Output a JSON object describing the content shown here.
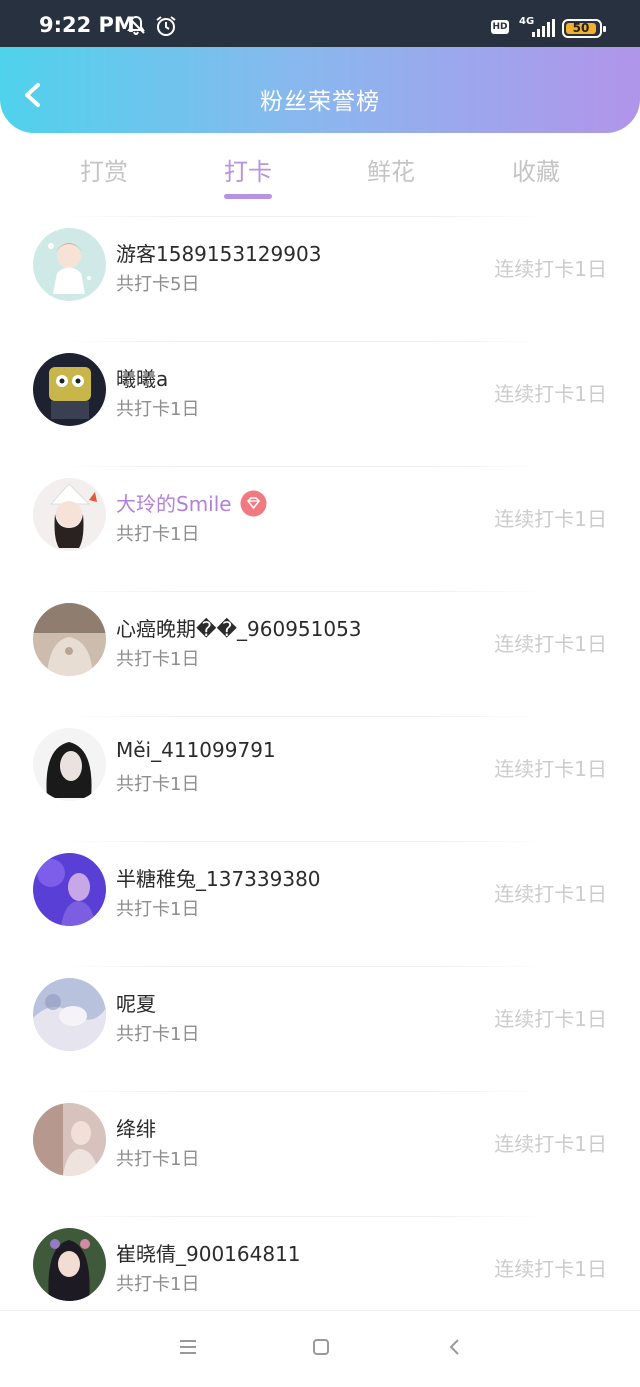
{
  "status_bar": {
    "time": "9:22 PM",
    "hd": "HD",
    "network": "4G",
    "battery": "50",
    "icons": [
      "bell-off-icon",
      "alarm-icon",
      "signal-icon",
      "battery-icon"
    ]
  },
  "header": {
    "title": "粉丝荣誉榜",
    "back_icon": "chevron-left-icon",
    "gradient": [
      "#4fd2ec",
      "#87b9ef",
      "#b195ea"
    ]
  },
  "tabs": [
    {
      "label": "打赏",
      "active": false
    },
    {
      "label": "打卡",
      "active": true
    },
    {
      "label": "鲜花",
      "active": false
    },
    {
      "label": "收藏",
      "active": false
    }
  ],
  "accent_color": "#b893e3",
  "fans": [
    {
      "name": "游客1589153129903",
      "total": "共打卡5日",
      "streak": "连续打卡1日",
      "vip": false
    },
    {
      "name": "曦曦a",
      "total": "共打卡1日",
      "streak": "连续打卡1日",
      "vip": false
    },
    {
      "name": "大玲的Smile",
      "total": "共打卡1日",
      "streak": "连续打卡1日",
      "vip": true
    },
    {
      "name": "心癌晚期��_960951053",
      "total": "共打卡1日",
      "streak": "连续打卡1日",
      "vip": false
    },
    {
      "name": "Měi_411099791",
      "total": "共打卡1日",
      "streak": "连续打卡1日",
      "vip": false
    },
    {
      "name": "半糖稚兔_137339380",
      "total": "共打卡1日",
      "streak": "连续打卡1日",
      "vip": false
    },
    {
      "name": "呢夏",
      "total": "共打卡1日",
      "streak": "连续打卡1日",
      "vip": false
    },
    {
      "name": "绛绯",
      "total": "共打卡1日",
      "streak": "连续打卡1日",
      "vip": false
    },
    {
      "name": "崔晓倩_900164811",
      "total": "共打卡1日",
      "streak": "连续打卡1日",
      "vip": false
    }
  ],
  "nav": [
    "menu-icon",
    "home-icon",
    "back-icon"
  ]
}
